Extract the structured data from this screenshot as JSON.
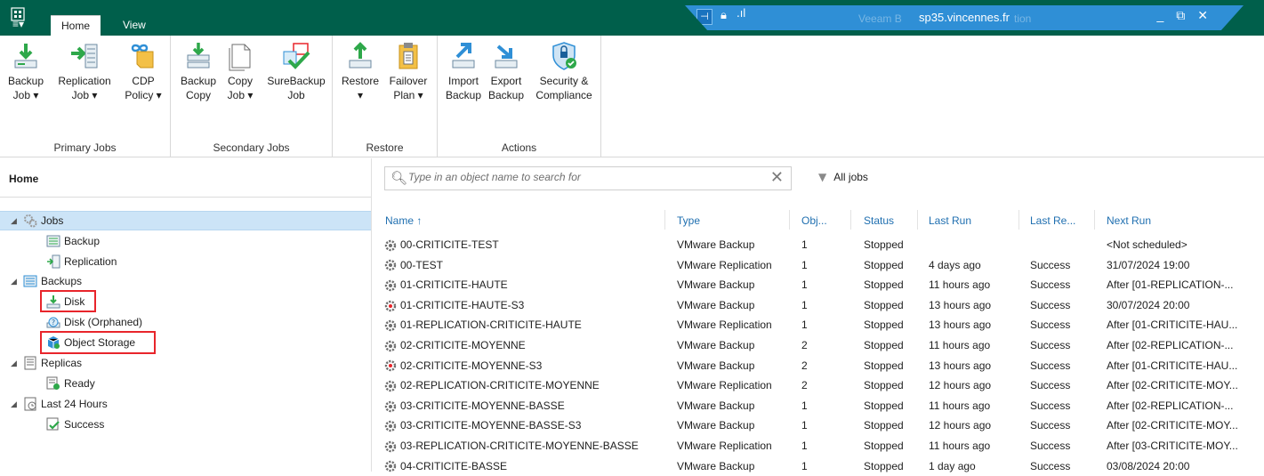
{
  "titlebar": {
    "app_icon": "veeam-app-icon",
    "remote_title": "sp35.vincennes.fr",
    "behind_text_left": "Veeam B",
    "behind_text_right": "tion",
    "controls": {
      "minimize": "_",
      "restore": "⧉",
      "close": "✕"
    }
  },
  "menu": {
    "hamburger": "≡▾",
    "tabs": [
      {
        "label": "Home",
        "active": true
      },
      {
        "label": "View",
        "active": false
      }
    ]
  },
  "ribbon": {
    "groups": [
      {
        "label": "Primary Jobs",
        "buttons": [
          {
            "line1": "Backup",
            "line2": "Job ▾",
            "icon": "backup-job-icon"
          },
          {
            "line1": "Replication",
            "line2": "Job ▾",
            "icon": "replication-job-icon"
          },
          {
            "line1": "CDP",
            "line2": "Policy ▾",
            "icon": "cdp-policy-icon"
          }
        ]
      },
      {
        "label": "Secondary Jobs",
        "buttons": [
          {
            "line1": "Backup",
            "line2": "Copy",
            "icon": "backup-copy-icon"
          },
          {
            "line1": "Copy",
            "line2": "Job ▾",
            "icon": "copy-job-icon"
          },
          {
            "line1": "SureBackup",
            "line2": "Job",
            "icon": "surebackup-job-icon"
          }
        ]
      },
      {
        "label": "Restore",
        "buttons": [
          {
            "line1": "Restore",
            "line2": "▾",
            "icon": "restore-icon"
          },
          {
            "line1": "Failover",
            "line2": "Plan ▾",
            "icon": "failover-plan-icon"
          }
        ]
      },
      {
        "label": "Actions",
        "buttons": [
          {
            "line1": "Import",
            "line2": "Backup",
            "icon": "import-backup-icon"
          },
          {
            "line1": "Export",
            "line2": "Backup",
            "icon": "export-backup-icon"
          },
          {
            "line1": "Security &",
            "line2": "Compliance",
            "icon": "security-compliance-icon"
          }
        ]
      }
    ]
  },
  "nav": {
    "header": "Home",
    "tree": [
      {
        "label": "Jobs",
        "level": 0,
        "expanded": true,
        "selected": true,
        "icon": "jobs-gear-icon"
      },
      {
        "label": "Backup",
        "level": 1,
        "icon": "backup-jobs-icon"
      },
      {
        "label": "Replication",
        "level": 1,
        "icon": "replication-jobs-icon"
      },
      {
        "label": "Backups",
        "level": 0,
        "expanded": true,
        "icon": "backups-icon"
      },
      {
        "label": "Disk",
        "level": 1,
        "icon": "disk-icon",
        "highlighted": true
      },
      {
        "label": "Disk (Orphaned)",
        "level": 1,
        "icon": "disk-orphaned-icon"
      },
      {
        "label": "Object Storage",
        "level": 1,
        "icon": "object-storage-icon",
        "highlighted": true
      },
      {
        "label": "Replicas",
        "level": 0,
        "expanded": true,
        "icon": "replicas-icon"
      },
      {
        "label": "Ready",
        "level": 1,
        "icon": "ready-icon"
      },
      {
        "label": "Last 24 Hours",
        "level": 0,
        "expanded": true,
        "icon": "last-24-hours-icon"
      },
      {
        "label": "Success",
        "level": 1,
        "icon": "success-icon"
      }
    ]
  },
  "search": {
    "placeholder": "Type in an object name to search for",
    "value": ""
  },
  "filter": {
    "label": "All jobs"
  },
  "table": {
    "columns": [
      "Name ↑",
      "Type",
      "Obj...",
      "Status",
      "Last Run",
      "Last Re...",
      "Next Run"
    ],
    "rows": [
      {
        "name": "00-CRITICITE-TEST",
        "type": "VMware Backup",
        "obj": "1",
        "status": "Stopped",
        "last_run": "",
        "last_result": "",
        "next_run": "<Not scheduled>",
        "icon": "backup-job-gear-icon"
      },
      {
        "name": "00-TEST",
        "type": "VMware Replication",
        "obj": "1",
        "status": "Stopped",
        "last_run": "4 days ago",
        "last_result": "Success",
        "next_run": "31/07/2024 19:00",
        "icon": "backup-job-gear-icon"
      },
      {
        "name": "01-CRITICITE-HAUTE",
        "type": "VMware Backup",
        "obj": "1",
        "status": "Stopped",
        "last_run": "11 hours ago",
        "last_result": "Success",
        "next_run": "After [01-REPLICATION-...",
        "icon": "backup-job-gear-icon"
      },
      {
        "name": "01-CRITICITE-HAUTE-S3",
        "type": "VMware Backup",
        "obj": "1",
        "status": "Stopped",
        "last_run": "13 hours ago",
        "last_result": "Success",
        "next_run": "30/07/2024 20:00",
        "icon": "backup-copy-gear-icon"
      },
      {
        "name": "01-REPLICATION-CRITICITE-HAUTE",
        "type": "VMware Replication",
        "obj": "1",
        "status": "Stopped",
        "last_run": "13 hours ago",
        "last_result": "Success",
        "next_run": "After [01-CRITICITE-HAU...",
        "icon": "backup-job-gear-icon"
      },
      {
        "name": "02-CRITICITE-MOYENNE",
        "type": "VMware Backup",
        "obj": "2",
        "status": "Stopped",
        "last_run": "11 hours ago",
        "last_result": "Success",
        "next_run": "After [02-REPLICATION-...",
        "icon": "backup-job-gear-icon"
      },
      {
        "name": "02-CRITICITE-MOYENNE-S3",
        "type": "VMware Backup",
        "obj": "2",
        "status": "Stopped",
        "last_run": "13 hours ago",
        "last_result": "Success",
        "next_run": "After [01-CRITICITE-HAU...",
        "icon": "backup-copy-gear-icon"
      },
      {
        "name": "02-REPLICATION-CRITICITE-MOYENNE",
        "type": "VMware Replication",
        "obj": "2",
        "status": "Stopped",
        "last_run": "12 hours ago",
        "last_result": "Success",
        "next_run": "After [02-CRITICITE-MOY...",
        "icon": "backup-job-gear-icon"
      },
      {
        "name": "03-CRITICITE-MOYENNE-BASSE",
        "type": "VMware Backup",
        "obj": "1",
        "status": "Stopped",
        "last_run": "11 hours ago",
        "last_result": "Success",
        "next_run": "After [02-REPLICATION-...",
        "icon": "backup-job-gear-icon"
      },
      {
        "name": "03-CRITICITE-MOYENNE-BASSE-S3",
        "type": "VMware Backup",
        "obj": "1",
        "status": "Stopped",
        "last_run": "12 hours ago",
        "last_result": "Success",
        "next_run": "After [02-CRITICITE-MOY...",
        "icon": "backup-job-gear-icon"
      },
      {
        "name": "03-REPLICATION-CRITICITE-MOYENNE-BASSE",
        "type": "VMware Replication",
        "obj": "1",
        "status": "Stopped",
        "last_run": "11 hours ago",
        "last_result": "Success",
        "next_run": "After [03-CRITICITE-MOY...",
        "icon": "backup-job-gear-icon"
      },
      {
        "name": "04-CRITICITE-BASSE",
        "type": "VMware Backup",
        "obj": "1",
        "status": "Stopped",
        "last_run": "1 day ago",
        "last_result": "Success",
        "next_run": "03/08/2024 20:00",
        "icon": "backup-job-gear-icon"
      }
    ]
  },
  "colors": {
    "titlebar": "#005f4b",
    "rdp_bar": "#2f8fd6",
    "link_blue": "#1f6fb0",
    "selection": "#cce4f7",
    "highlight_box": "#e8252b"
  }
}
